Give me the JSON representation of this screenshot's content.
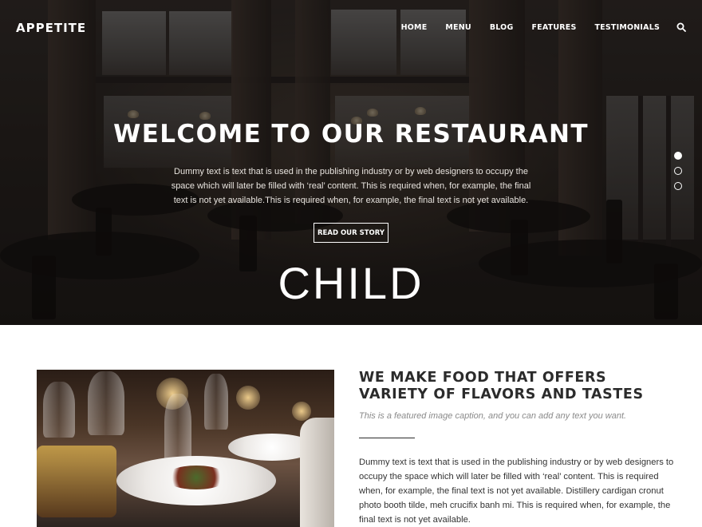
{
  "header": {
    "logo": "APPETITE",
    "nav": [
      "HOME",
      "MENU",
      "BLOG",
      "FEATURES",
      "TESTIMONIALS"
    ],
    "search_icon": "search-icon"
  },
  "hero": {
    "title": "WELCOME TO OUR RESTAURANT",
    "text": "Dummy text is text that is used in the publishing industry or by web designers to occupy the space which will later be filled with ‘real’ content. This is required when, for example, the final text is not yet available.This is required when, for example, the final text is not yet available.",
    "button": "READ OUR STORY",
    "overlay_text": "CHILD",
    "slides": 3,
    "active_slide": 1
  },
  "feature": {
    "title": "WE MAKE FOOD THAT OFFERS VARIETY OF FLAVORS AND TASTES",
    "caption": "This is a featured image caption, and you can add any text you want.",
    "body": "Dummy text is text that is used in the publishing industry or by web designers to occupy the space which will later be filled with ‘real’ content. This is required when, for example, the final text is not yet available. Distillery cardigan cronut photo booth tilde, meh crucifix banh mi. This is required when, for example, the final text is not yet available."
  },
  "colors": {
    "text_dark": "#2b2b2b",
    "caption": "#8a8a8a",
    "hero_text": "#ffffff"
  }
}
